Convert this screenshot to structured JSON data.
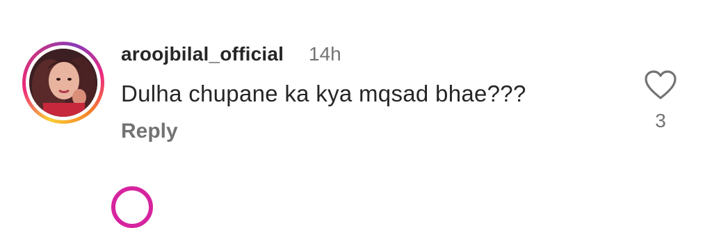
{
  "comment": {
    "username": "aroojbilal_official",
    "time": "14h",
    "text": "Dulha chupane ka kya mqsad bhae???",
    "reply_label": "Reply",
    "like_count": "3",
    "like_icon": "heart-outline-icon",
    "colors": {
      "username": "#262626",
      "secondary": "#737373",
      "story_ring": [
        "#f9ce34",
        "#ee2a7b",
        "#8a3ab9"
      ]
    }
  }
}
